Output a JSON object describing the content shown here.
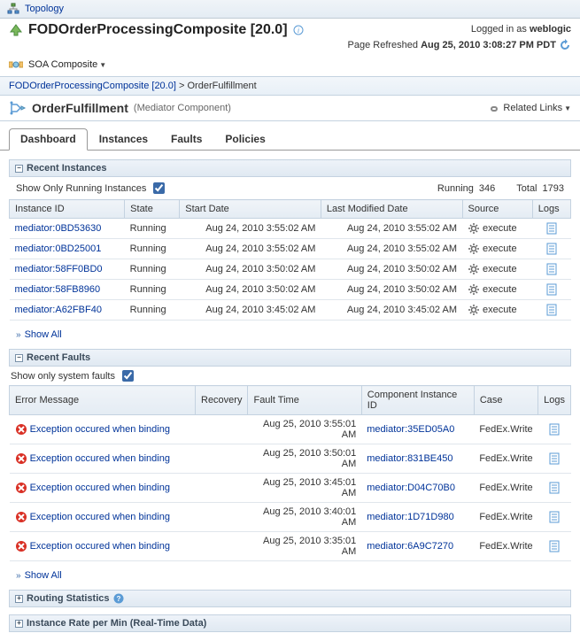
{
  "topbar": {
    "label": "Topology"
  },
  "header": {
    "title": "FODOrderProcessingComposite [20.0]",
    "logged_in": "Logged in as",
    "user": "weblogic",
    "refreshed_label": "Page Refreshed",
    "refreshed_time": "Aug 25, 2010 3:08:27 PM PDT"
  },
  "subbar": {
    "menu": "SOA Composite"
  },
  "breadcrumb": {
    "parent": "FODOrderProcessingComposite [20.0]",
    "sep": ">",
    "current": "OrderFulfillment"
  },
  "component": {
    "title": "OrderFulfillment",
    "subtitle": "(Mediator Component)",
    "related": "Related Links"
  },
  "tabs": [
    {
      "label": "Dashboard",
      "active": true
    },
    {
      "label": "Instances",
      "active": false
    },
    {
      "label": "Faults",
      "active": false
    },
    {
      "label": "Policies",
      "active": false
    }
  ],
  "instances": {
    "title": "Recent Instances",
    "filter_label": "Show Only Running Instances",
    "filter_checked": true,
    "running_label": "Running",
    "running_count": "346",
    "total_label": "Total",
    "total_count": "1793",
    "columns": [
      "Instance ID",
      "State",
      "Start Date",
      "Last Modified Date",
      "Source",
      "Logs"
    ],
    "rows": [
      {
        "id": "mediator:0BD53630",
        "state": "Running",
        "start": "Aug 24, 2010 3:55:02 AM",
        "mod": "Aug 24, 2010 3:55:02 AM",
        "source": "execute"
      },
      {
        "id": "mediator:0BD25001",
        "state": "Running",
        "start": "Aug 24, 2010 3:55:02 AM",
        "mod": "Aug 24, 2010 3:55:02 AM",
        "source": "execute"
      },
      {
        "id": "mediator:58FF0BD0",
        "state": "Running",
        "start": "Aug 24, 2010 3:50:02 AM",
        "mod": "Aug 24, 2010 3:50:02 AM",
        "source": "execute"
      },
      {
        "id": "mediator:58FB8960",
        "state": "Running",
        "start": "Aug 24, 2010 3:50:02 AM",
        "mod": "Aug 24, 2010 3:50:02 AM",
        "source": "execute"
      },
      {
        "id": "mediator:A62FBF40",
        "state": "Running",
        "start": "Aug 24, 2010 3:45:02 AM",
        "mod": "Aug 24, 2010 3:45:02 AM",
        "source": "execute"
      }
    ],
    "show_all": "Show All"
  },
  "faults": {
    "title": "Recent Faults",
    "filter_label": "Show only system faults",
    "filter_checked": true,
    "columns": [
      "Error Message",
      "Recovery",
      "Fault Time",
      "Component Instance ID",
      "Case",
      "Logs"
    ],
    "rows": [
      {
        "msg": "Exception occured when binding",
        "time": "Aug 25, 2010 3:55:01 AM",
        "cid": "mediator:35ED05A0",
        "case": "FedEx.Write"
      },
      {
        "msg": "Exception occured when binding",
        "time": "Aug 25, 2010 3:50:01 AM",
        "cid": "mediator:831BE450",
        "case": "FedEx.Write"
      },
      {
        "msg": "Exception occured when binding",
        "time": "Aug 25, 2010 3:45:01 AM",
        "cid": "mediator:D04C70B0",
        "case": "FedEx.Write"
      },
      {
        "msg": "Exception occured when binding",
        "time": "Aug 25, 2010 3:40:01 AM",
        "cid": "mediator:1D71D980",
        "case": "FedEx.Write"
      },
      {
        "msg": "Exception occured when binding",
        "time": "Aug 25, 2010 3:35:01 AM",
        "cid": "mediator:6A9C7270",
        "case": "FedEx.Write"
      }
    ],
    "show_all": "Show All"
  },
  "routing": {
    "title": "Routing Statistics"
  },
  "rate": {
    "title": "Instance Rate per Min (Real-Time Data)"
  }
}
